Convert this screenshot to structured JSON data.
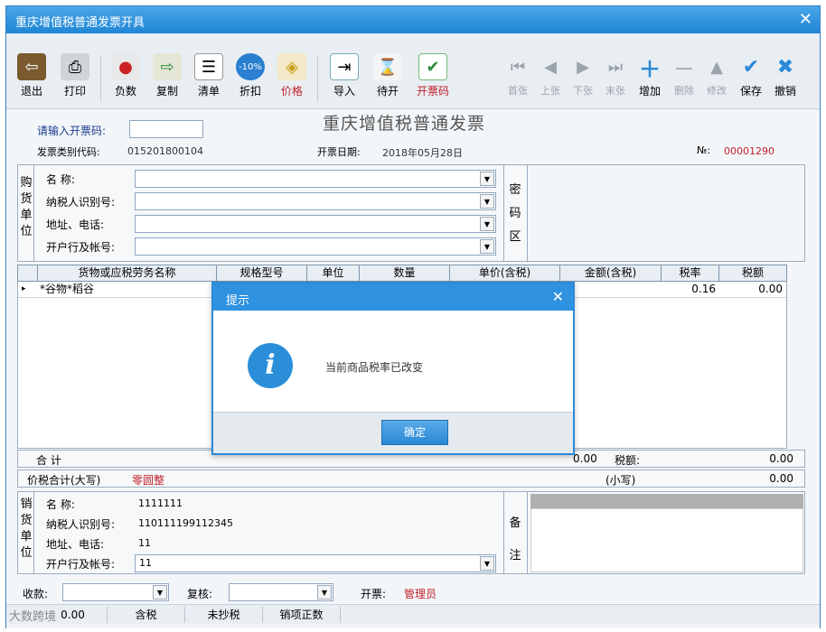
{
  "window": {
    "title": "重庆增值税普通发票开具"
  },
  "toolbar": {
    "exit": "退出",
    "print": "打印",
    "negative": "负数",
    "copy": "复制",
    "list": "清单",
    "discount": "折扣",
    "price": "价格",
    "import": "导入",
    "pending": "待开",
    "issue_code": "开票码",
    "first": "首张",
    "prev": "上张",
    "next": "下张",
    "last": "末张",
    "add": "增加",
    "delete": "删除",
    "modify": "修改",
    "save": "保存",
    "cancel": "撤销"
  },
  "invoice": {
    "heading": "重庆增值税普通发票",
    "code_prompt": "请输入开票码:",
    "type_code_label": "发票类别代码:",
    "type_code": "015201800104",
    "date_label": "开票日期:",
    "date": "2018年05月28日",
    "no_label": "№:",
    "no": "00001290"
  },
  "buyer": {
    "section_label": [
      "购",
      "货",
      "单",
      "位"
    ],
    "name_label": "名 称:",
    "taxid_label": "纳税人识别号:",
    "addr_label": "地址、电话:",
    "bank_label": "开户行及帐号:",
    "password_label": [
      "密",
      "码",
      "区"
    ]
  },
  "grid": {
    "headers": [
      "货物或应税劳务名称",
      "规格型号",
      "单位",
      "数量",
      "单价(含税)",
      "金额(含税)",
      "税率",
      "税额"
    ],
    "rows": [
      {
        "name": "*谷物*稻谷",
        "rate": "0.16",
        "tax": "0.00"
      }
    ]
  },
  "totals": {
    "sum_label": "合 计",
    "sum_amount": "0.00",
    "sum_tax_label": "税额:",
    "sum_tax": "0.00",
    "in_words_label": "价税合计(大写)",
    "in_words": "零圆整",
    "small_label": "(小写)",
    "small": "0.00"
  },
  "seller": {
    "section_label": [
      "销",
      "货",
      "单",
      "位"
    ],
    "name_label": "名 称:",
    "name": "1111111",
    "taxid_label": "纳税人识别号:",
    "taxid": "110111199112345",
    "addr_label": "地址、电话:",
    "addr": "11",
    "bank_label": "开户行及帐号:",
    "bank": "11",
    "note_label": [
      "备",
      "注"
    ]
  },
  "footer": {
    "payee_label": "收款:",
    "reviewer_label": "复核:",
    "drawer_label": "开票:",
    "drawer": "管理员"
  },
  "status": [
    "0.00",
    "含税",
    "未抄税",
    "销项正数"
  ],
  "watermark": "大数跨境",
  "dialog": {
    "title": "提示",
    "message": "当前商品税率已改变",
    "ok": "确定"
  }
}
